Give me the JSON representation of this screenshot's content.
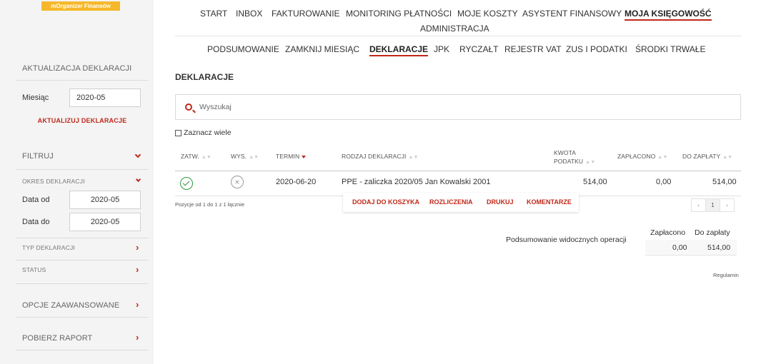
{
  "logo": {
    "text": "mOrganizer Finansów"
  },
  "sidebar": {
    "update_section": {
      "title": "AKTUALIZACJA DEKLARACJI",
      "month_label": "Miesiąc",
      "month_value": "2020-05",
      "update_link": "AKTUALIZUJ DEKLARACJE"
    },
    "filter": {
      "title": "FILTRUJ",
      "period_title": "OKRES DEKLARACJI",
      "date_from_label": "Data od",
      "date_from_value": "2020-05",
      "date_to_label": "Data do",
      "date_to_value": "2020-05",
      "type_label": "TYP DEKLARACJI",
      "status_label": "STATUS"
    },
    "advanced": "OPCJE ZAAWANSOWANE",
    "report": "POBIERZ RAPORT"
  },
  "topnav": {
    "items": [
      "START",
      "INBOX",
      "FAKTUROWANIE",
      "MONITORING PŁATNOŚCI",
      "MOJE KOSZTY",
      "ASYSTENT FINANSOWY",
      "MOJA KSIĘGOWOŚĆ",
      "ADMINISTRACJA"
    ]
  },
  "subnav": {
    "items": [
      "PODSUMOWANIE",
      "ZAMKNIJ MIESIĄC",
      "DEKLARACJE",
      "JPK",
      "RYCZAŁT",
      "REJESTR VAT",
      "ZUS I PODATKI",
      "ŚRODKI TRWAŁE"
    ]
  },
  "main": {
    "title": "DEKLARACJE",
    "search_placeholder": "Wyszukaj",
    "select_many": "Zaznacz wiele",
    "table": {
      "headers": {
        "approved": "ZATW.",
        "sent": "WYS.",
        "due": "TERMIN",
        "type": "RODZAJ DEKLARACJI",
        "tax_line1": "KWOTA",
        "tax_line2": "PODATKU",
        "paid": "ZAPŁACONO",
        "to_pay": "DO ZAPŁATY"
      },
      "rows": [
        {
          "approved_icon": "check-circle-icon",
          "sent_icon": "x-circle-icon",
          "due": "2020-06-20",
          "type": "PPE - zaliczka 2020/05 Jan Kowalski 2001",
          "tax": "514,00",
          "paid": "0,00",
          "to_pay": "514,00"
        }
      ]
    },
    "row_actions": [
      "DODAJ DO KOSZYKA",
      "ROZLICZENIA",
      "DRUKUJ",
      "KOMENTARZE"
    ],
    "pager_info": "Pozycje od 1 do 1 z 1 łącznie",
    "pager": {
      "prev": "‹",
      "page": "1",
      "next": "›"
    },
    "summary": {
      "label": "Podsumowanie widocznych operacji",
      "paid_head": "Zapłacono",
      "to_pay_head": "Do zapłaty",
      "paid_value": "0,00",
      "to_pay_value": "514,00"
    },
    "footer_link": "Regulamin"
  },
  "colors": {
    "accent": "#c0281a",
    "logo_bg": "#f6b82a",
    "ok": "#2b9a3a"
  }
}
